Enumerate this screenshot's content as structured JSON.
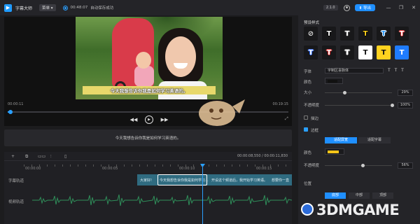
{
  "titlebar": {
    "app_title": "字幕大师",
    "menu_label": "菜单",
    "save_time": "00:48:07",
    "save_status": "自动保存成功",
    "version": "2.1.0",
    "export_label": "导出",
    "minimize": "—",
    "maximize": "❐",
    "close": "✕"
  },
  "preview": {
    "subtitle_overlay": "今天我想告诉你我是如何学习英语的。",
    "current_time": "00:00:11",
    "total_time": "00:19:15",
    "progress": 0.01,
    "controls": {
      "prev": "◀◀",
      "play": "▶",
      "next": "▶▶"
    },
    "fullscreen_icon": "⤢"
  },
  "subtitle_bar": {
    "text": "今天我想告诉你我是如何学习英语的。"
  },
  "timeline": {
    "tools": [
      "+",
      "⧉",
      "▭▭",
      "⫶",
      "▯"
    ],
    "time_readout": "00:00:08,550  /  00:00:11,830",
    "ruler_labels": [
      {
        "label": "00:00:00"
      },
      {
        "label": "00:00:05"
      },
      {
        "label": "00:00:10"
      },
      {
        "label": "00:00:15"
      }
    ],
    "tracks": {
      "subtitle": "字幕轨道",
      "audio": "视频轨道"
    },
    "clips": [
      "大家好!",
      "今天我想告诉你我是如何学习...",
      "开设这个频道后，我开始学习英语。",
      "想要你一直"
    ]
  },
  "panel": {
    "preset_title": "预设样式",
    "styles_row1": [
      {
        "glyph": "⊘",
        "color": "#dddddd",
        "bg": "#18181a",
        "stroke": ""
      },
      {
        "glyph": "T",
        "color": "#ffffff",
        "bg": "#18181a",
        "stroke": "#000000"
      },
      {
        "glyph": "T",
        "color": "#ffffff",
        "bg": "#18181a",
        "stroke": "#444444"
      },
      {
        "glyph": "T",
        "color": "#ffd21f",
        "bg": "#18181a",
        "stroke": "#000000"
      },
      {
        "glyph": "T",
        "color": "#2f9bff",
        "bg": "#18181a",
        "stroke": "#ffffff"
      },
      {
        "glyph": "T",
        "color": "#ffffff",
        "bg": "#18181a",
        "stroke": "#e33030"
      }
    ],
    "styles_row2": [
      {
        "glyph": "T",
        "color": "#ffffff",
        "bg": "#18181a",
        "stroke": "#2f6bff"
      },
      {
        "glyph": "T",
        "color": "#ffffff",
        "bg": "#18181a",
        "stroke": "#e33030"
      },
      {
        "glyph": "T",
        "color": "#ffffff",
        "bg": "#18181a",
        "stroke": "#888888"
      },
      {
        "glyph": "T",
        "color": "#111111",
        "bg": "#ffffff",
        "stroke": ""
      },
      {
        "glyph": "T",
        "color": "#111111",
        "bg": "#ffd21f",
        "stroke": ""
      },
      {
        "glyph": "T",
        "color": "#ffffff",
        "bg": "#1f7cff",
        "stroke": ""
      }
    ],
    "font_label": "字体",
    "font_value": "字制区喜脉体",
    "font_style_icons": "T T T",
    "color_label": "颜色",
    "text_color": "#111111",
    "size_label": "大小",
    "size_value": "29%",
    "size_level": 0.29,
    "opacity_label": "不透明度",
    "opacity_value": "100%",
    "opacity_level": 1.0,
    "stroke_label": "描边",
    "stroke_checked": false,
    "border_label": "边框",
    "border_checked": true,
    "border_modes": [
      "适配屏宽",
      "适配字幕"
    ],
    "border_color_label": "颜色",
    "border_color": "#f5c518",
    "border_opacity_label": "不透明度",
    "border_opacity_value": "56%",
    "border_opacity_level": 0.56,
    "position_label": "位置",
    "positions": [
      "底部",
      "中部",
      "顶部"
    ]
  },
  "watermark": "3DMGAME"
}
